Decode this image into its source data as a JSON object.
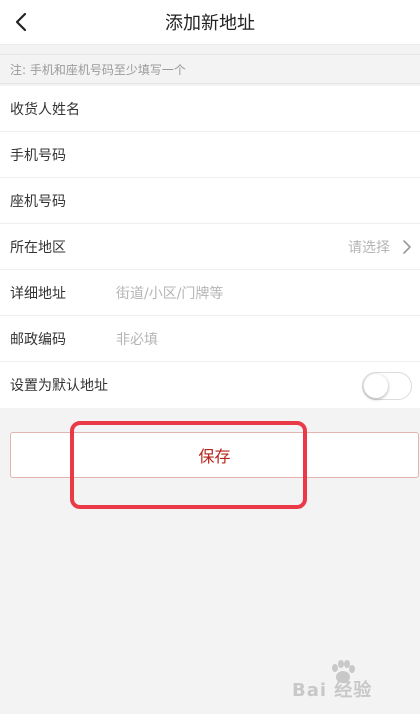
{
  "header": {
    "title": "添加新地址",
    "back_icon": "chevron-left-icon"
  },
  "note": "注: 手机和座机号码至少填写一个",
  "form": {
    "fields": [
      {
        "label": "收货人姓名",
        "value": "",
        "placeholder": ""
      },
      {
        "label": "手机号码",
        "value": "",
        "placeholder": ""
      },
      {
        "label": "座机号码",
        "value": "",
        "placeholder": ""
      },
      {
        "label": "所在地区",
        "value": "",
        "placeholder": "请选择",
        "icon": "chevron-right-icon"
      },
      {
        "label": "详细地址",
        "value": "",
        "placeholder": "街道/小区/门牌等"
      },
      {
        "label": "邮政编码",
        "value": "",
        "placeholder": "非必填"
      }
    ],
    "default_toggle": {
      "label": "设置为默认地址",
      "on": false
    }
  },
  "save_button": {
    "label": "保存",
    "text_color": "#b5231a"
  },
  "highlight_color": "#ea3a48",
  "watermark": {
    "text": "Bai 经验"
  }
}
